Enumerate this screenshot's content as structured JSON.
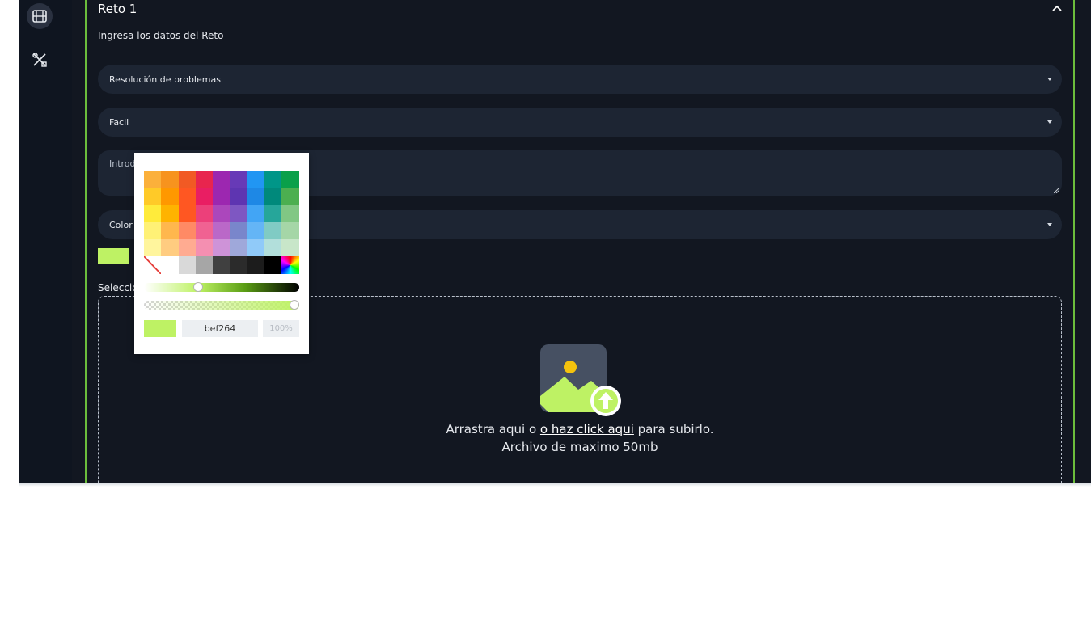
{
  "section": {
    "title": "Reto 1",
    "subtitle": "Ingresa los datos del Reto"
  },
  "form": {
    "category_value": "Resolución de problemas",
    "difficulty_value": "Facil",
    "intro_text": "Introd",
    "color_label": "Color",
    "selected_color": "#bef264",
    "select_label": "Seleccio"
  },
  "upload": {
    "prefix": "Arrastra aqui o ",
    "link": "o haz click aqui",
    "suffix": " para subirlo.",
    "limit": "Archivo de maximo 50mb"
  },
  "picker": {
    "hex_value": "bef264",
    "alpha_value": "100%",
    "hue_position": 0.34,
    "alpha_level": 1.0,
    "palette": [
      [
        "#fbb03b",
        "#f7931e",
        "#f15a24",
        "#e8254e",
        "#9c27b0",
        "#673ab7",
        "#2196f3",
        "#009688",
        "#0aa04a"
      ],
      [
        "#ffca28",
        "#ff9800",
        "#ff5722",
        "#e91e63",
        "#9c27b0",
        "#5e35b1",
        "#1e88e5",
        "#00897b",
        "#4caf50"
      ],
      [
        "#ffeb3b",
        "#ffb300",
        "#ff5722",
        "#ec407a",
        "#ab47bc",
        "#7e57c2",
        "#42a5f5",
        "#26a69a",
        "#81c784"
      ],
      [
        "#fff176",
        "#ffb74d",
        "#ff8a65",
        "#f06292",
        "#ba68c8",
        "#7986cb",
        "#64b5f6",
        "#80cbc4",
        "#a5d6a7"
      ],
      [
        "#fff59d",
        "#ffcc80",
        "#ffab91",
        "#f48fb1",
        "#ce93d8",
        "#9fa8da",
        "#90caf9",
        "#b2dfdb",
        "#c8e6c9"
      ],
      [
        "none",
        "#ffffff",
        "#d9d9d9",
        "#a6a6a6",
        "#404040",
        "#2b2b2b",
        "#1c1c1c",
        "#000000",
        "spectrum"
      ]
    ]
  },
  "colors": {
    "accent": "#6bbd3c",
    "lime": "#bef264",
    "background": "#121721",
    "field": "#1d2533"
  },
  "icons": {
    "film": "film-icon",
    "tools": "tools-icon",
    "collapse": "chevron-up-icon",
    "upload": "image-upload-icon"
  }
}
